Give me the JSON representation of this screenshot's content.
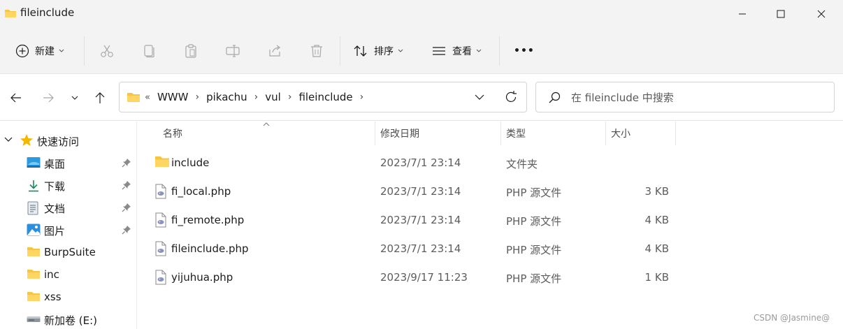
{
  "window": {
    "title": "fileinclude"
  },
  "toolbar": {
    "new_label": "新建",
    "sort_label": "排序",
    "view_label": "查看",
    "more_label": "•••"
  },
  "address": {
    "lead": "«",
    "crumbs": [
      "WWW",
      "pikachu",
      "vul",
      "fileinclude"
    ]
  },
  "search": {
    "placeholder": "在 fileinclude 中搜索"
  },
  "sidebar": {
    "quick_access": "快速访问",
    "items": [
      {
        "label": "桌面",
        "icon": "desktop-icon",
        "pinned": true
      },
      {
        "label": "下载",
        "icon": "download-icon",
        "pinned": true
      },
      {
        "label": "文档",
        "icon": "document-icon",
        "pinned": true
      },
      {
        "label": "图片",
        "icon": "picture-icon",
        "pinned": true
      },
      {
        "label": "BurpSuite",
        "icon": "folder-icon",
        "pinned": false
      },
      {
        "label": "inc",
        "icon": "folder-icon",
        "pinned": false
      },
      {
        "label": "xss",
        "icon": "folder-icon",
        "pinned": false
      },
      {
        "label": "新加卷 (E:)",
        "icon": "drive-icon",
        "pinned": false
      }
    ]
  },
  "columns": {
    "name": "名称",
    "date": "修改日期",
    "type": "类型",
    "size": "大小"
  },
  "files": [
    {
      "name": "include",
      "date": "2023/7/1 23:14",
      "type": "文件夹",
      "size": "",
      "icon": "folder-icon"
    },
    {
      "name": "fi_local.php",
      "date": "2023/7/1 23:14",
      "type": "PHP 源文件",
      "size": "3 KB",
      "icon": "php-file-icon"
    },
    {
      "name": "fi_remote.php",
      "date": "2023/7/1 23:14",
      "type": "PHP 源文件",
      "size": "4 KB",
      "icon": "php-file-icon"
    },
    {
      "name": "fileinclude.php",
      "date": "2023/7/1 23:14",
      "type": "PHP 源文件",
      "size": "4 KB",
      "icon": "php-file-icon"
    },
    {
      "name": "yijuhua.php",
      "date": "2023/9/17 11:23",
      "type": "PHP 源文件",
      "size": "1 KB",
      "icon": "php-file-icon"
    }
  ],
  "watermark": "CSDN @Jasmine@"
}
